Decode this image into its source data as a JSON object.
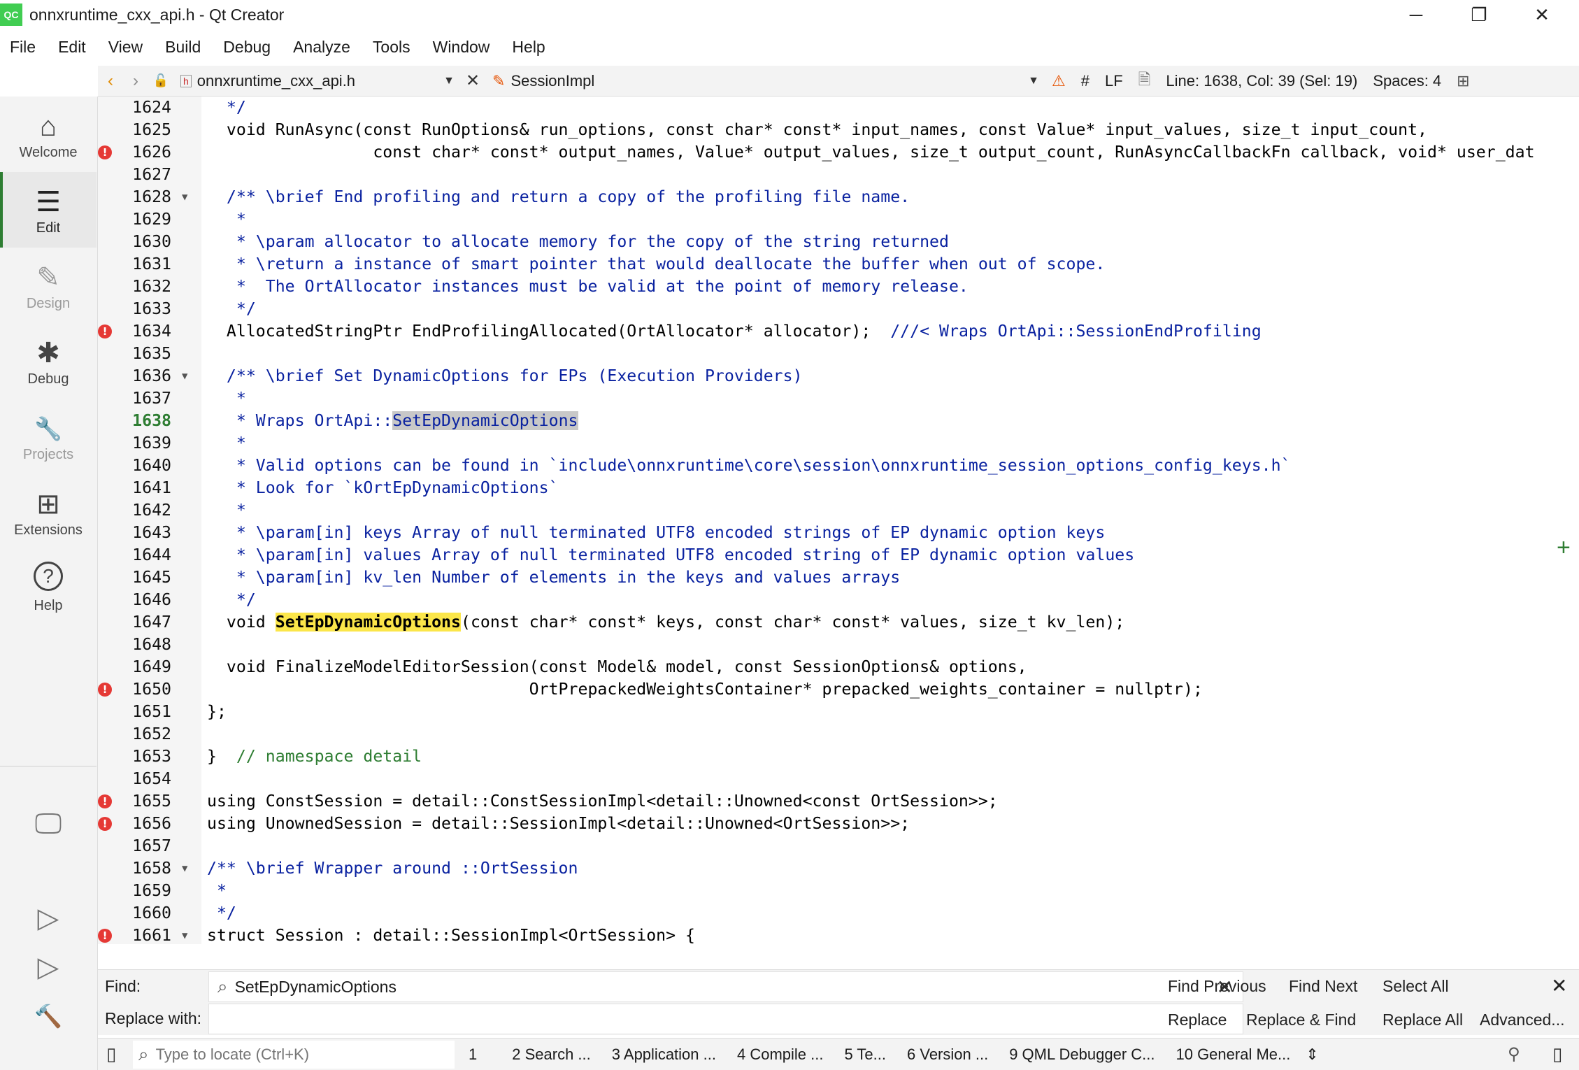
{
  "window": {
    "logo_text": "QC",
    "title": "onnxruntime_cxx_api.h - Qt Creator",
    "minimize": "─",
    "maximize": "❐",
    "close": "✕"
  },
  "menu": [
    "File",
    "Edit",
    "View",
    "Build",
    "Debug",
    "Analyze",
    "Tools",
    "Window",
    "Help"
  ],
  "toolbar": {
    "back": "‹",
    "forward": "›",
    "lock": "🔓",
    "file_icon": "h",
    "file_name": "onnxruntime_cxx_api.h",
    "close_file": "✕",
    "symbol": "SessionImpl",
    "warning": "⚠",
    "hash": "#",
    "line_ending": "LF",
    "encoding_icon": "🗎",
    "cursor_position": "Line: 1638, Col: 39 (Sel: 19)",
    "indent": "Spaces: 4",
    "split": "⊞"
  },
  "modes": [
    {
      "label": "Welcome",
      "glyph": "⌂",
      "icon": "home-icon"
    },
    {
      "label": "Edit",
      "glyph": "☰",
      "icon": "edit-icon"
    },
    {
      "label": "Design",
      "glyph": "✎",
      "icon": "design-pen-icon"
    },
    {
      "label": "Debug",
      "glyph": "✱",
      "icon": "debug-bug-icon"
    },
    {
      "label": "Projects",
      "glyph": "🔧",
      "icon": "projects-wrench-icon"
    },
    {
      "label": "Extensions",
      "glyph": "⊞",
      "icon": "extensions-icon"
    },
    {
      "label": "Help",
      "glyph": "?",
      "icon": "help-icon"
    }
  ],
  "sidebar_actions": {
    "kit": "🖵",
    "run": "▷",
    "debug_run": "▷",
    "build": "🔨"
  },
  "code_lines": [
    {
      "n": "1624",
      "parts": [
        {
          "t": "  */",
          "c": "comment"
        }
      ]
    },
    {
      "n": "1625",
      "parts": [
        {
          "t": "  void RunAsync(const RunOptions& run_options, const char* const* input_names, const Value* input_values, size_t input_count,",
          "c": ""
        }
      ]
    },
    {
      "n": "1626",
      "err": true,
      "parts": [
        {
          "t": "                 const char* const* output_names, Value* output_values, size_t output_count, RunAsyncCallbackFn callback, void* user_dat",
          "c": ""
        }
      ]
    },
    {
      "n": "1627",
      "parts": [
        {
          "t": "",
          "c": ""
        }
      ]
    },
    {
      "n": "1628",
      "fold": true,
      "parts": [
        {
          "t": "  /** \\brief End profiling and return a copy of the profiling file name.",
          "c": "comment"
        }
      ]
    },
    {
      "n": "1629",
      "parts": [
        {
          "t": "   *",
          "c": "comment"
        }
      ]
    },
    {
      "n": "1630",
      "parts": [
        {
          "t": "   * \\param allocator to allocate memory for the copy of the string returned",
          "c": "comment"
        }
      ]
    },
    {
      "n": "1631",
      "parts": [
        {
          "t": "   * \\return a instance of smart pointer that would deallocate the buffer when out of scope.",
          "c": "comment"
        }
      ]
    },
    {
      "n": "1632",
      "parts": [
        {
          "t": "   *  The OrtAllocator instances must be valid at the point of memory release.",
          "c": "comment"
        }
      ]
    },
    {
      "n": "1633",
      "parts": [
        {
          "t": "   */",
          "c": "comment"
        }
      ]
    },
    {
      "n": "1634",
      "err": true,
      "parts": [
        {
          "t": "  AllocatedStringPtr EndProfilingAllocated(OrtAllocator* allocator);  ",
          "c": ""
        },
        {
          "t": "///< Wraps OrtApi::SessionEndProfiling",
          "c": "comment"
        }
      ]
    },
    {
      "n": "1635",
      "parts": [
        {
          "t": "",
          "c": ""
        }
      ]
    },
    {
      "n": "1636",
      "fold": true,
      "parts": [
        {
          "t": "  /** \\brief Set DynamicOptions for EPs (Execution Providers)",
          "c": "comment"
        }
      ]
    },
    {
      "n": "1637",
      "parts": [
        {
          "t": "   *",
          "c": "comment"
        }
      ]
    },
    {
      "n": "1638",
      "current": true,
      "parts": [
        {
          "t": "   * Wraps OrtApi::",
          "c": "comment"
        },
        {
          "t": "SetEpDynamicOptions",
          "c": "comment sel"
        }
      ]
    },
    {
      "n": "1639",
      "parts": [
        {
          "t": "   *",
          "c": "comment"
        }
      ]
    },
    {
      "n": "1640",
      "parts": [
        {
          "t": "   * Valid options can be found in `include\\onnxruntime\\core\\session\\onnxruntime_session_options_config_keys.h`",
          "c": "comment"
        }
      ]
    },
    {
      "n": "1641",
      "parts": [
        {
          "t": "   * Look for `kOrtEpDynamicOptions`",
          "c": "comment"
        }
      ]
    },
    {
      "n": "1642",
      "parts": [
        {
          "t": "   *",
          "c": "comment"
        }
      ]
    },
    {
      "n": "1643",
      "parts": [
        {
          "t": "   * \\param[in] keys Array of null terminated UTF8 encoded strings of EP dynamic option keys",
          "c": "comment"
        }
      ]
    },
    {
      "n": "1644",
      "parts": [
        {
          "t": "   * \\param[in] values Array of null terminated UTF8 encoded string of EP dynamic option values",
          "c": "comment"
        }
      ]
    },
    {
      "n": "1645",
      "parts": [
        {
          "t": "   * \\param[in] kv_len Number of elements in the keys and values arrays",
          "c": "comment"
        }
      ]
    },
    {
      "n": "1646",
      "parts": [
        {
          "t": "   */",
          "c": "comment"
        }
      ]
    },
    {
      "n": "1647",
      "parts": [
        {
          "t": "  void ",
          "c": ""
        },
        {
          "t": "SetEpDynamicOptions",
          "c": "hl"
        },
        {
          "t": "(const char* const* keys, const char* const* values, size_t kv_len);",
          "c": ""
        }
      ]
    },
    {
      "n": "1648",
      "parts": [
        {
          "t": "",
          "c": ""
        }
      ]
    },
    {
      "n": "1649",
      "parts": [
        {
          "t": "  void FinalizeModelEditorSession(const Model& model, const SessionOptions& options,",
          "c": ""
        }
      ]
    },
    {
      "n": "1650",
      "err": true,
      "parts": [
        {
          "t": "                                 OrtPrepackedWeightsContainer* prepacked_weights_container = nullptr);",
          "c": ""
        }
      ]
    },
    {
      "n": "1651",
      "parts": [
        {
          "t": "};",
          "c": ""
        }
      ]
    },
    {
      "n": "1652",
      "parts": [
        {
          "t": "",
          "c": ""
        }
      ]
    },
    {
      "n": "1653",
      "parts": [
        {
          "t": "}  ",
          "c": ""
        },
        {
          "t": "// namespace detail",
          "c": "ns"
        }
      ]
    },
    {
      "n": "1654",
      "parts": [
        {
          "t": "",
          "c": ""
        }
      ]
    },
    {
      "n": "1655",
      "err": true,
      "parts": [
        {
          "t": "using ConstSession = detail::ConstSessionImpl<detail::Unowned<const OrtSession>>;",
          "c": ""
        }
      ]
    },
    {
      "n": "1656",
      "err": true,
      "parts": [
        {
          "t": "using UnownedSession = detail::SessionImpl<detail::Unowned<OrtSession>>;",
          "c": ""
        }
      ]
    },
    {
      "n": "1657",
      "parts": [
        {
          "t": "",
          "c": ""
        }
      ]
    },
    {
      "n": "1658",
      "fold": true,
      "parts": [
        {
          "t": "/** \\brief Wrapper around ::OrtSession",
          "c": "comment"
        }
      ]
    },
    {
      "n": "1659",
      "parts": [
        {
          "t": " *",
          "c": "comment"
        }
      ]
    },
    {
      "n": "1660",
      "parts": [
        {
          "t": " */",
          "c": "comment"
        }
      ]
    },
    {
      "n": "1661",
      "err": true,
      "fold": true,
      "parts": [
        {
          "t": "struct Session : detail::SessionImpl<OrtSession> {",
          "c": ""
        }
      ]
    }
  ],
  "find": {
    "find_label": "Find:",
    "replace_label": "Replace with:",
    "search_icon": "⌕",
    "find_value": "SetEpDynamicOptions",
    "clear": "✕",
    "find_previous": "Find Previous",
    "find_next": "Find Next",
    "select_all": "Select All",
    "close": "✕",
    "replace": "Replace",
    "replace_find": "Replace & Find",
    "replace_all": "Replace All",
    "advanced": "Advanced..."
  },
  "status": {
    "sidebar_toggle": "▯",
    "locator_icon": "⌕",
    "locator_placeholder": "Type to locate (Ctrl+K)",
    "panes": [
      "1",
      "2  Search ...",
      "3  Application ...",
      "4  Compile ...",
      "5  Te...",
      "6  Version ...",
      "9  QML Debugger C...",
      "10  General Me..."
    ],
    "updown": "⇕",
    "right_icon_1": "⚲",
    "right_icon_2": "▯"
  }
}
